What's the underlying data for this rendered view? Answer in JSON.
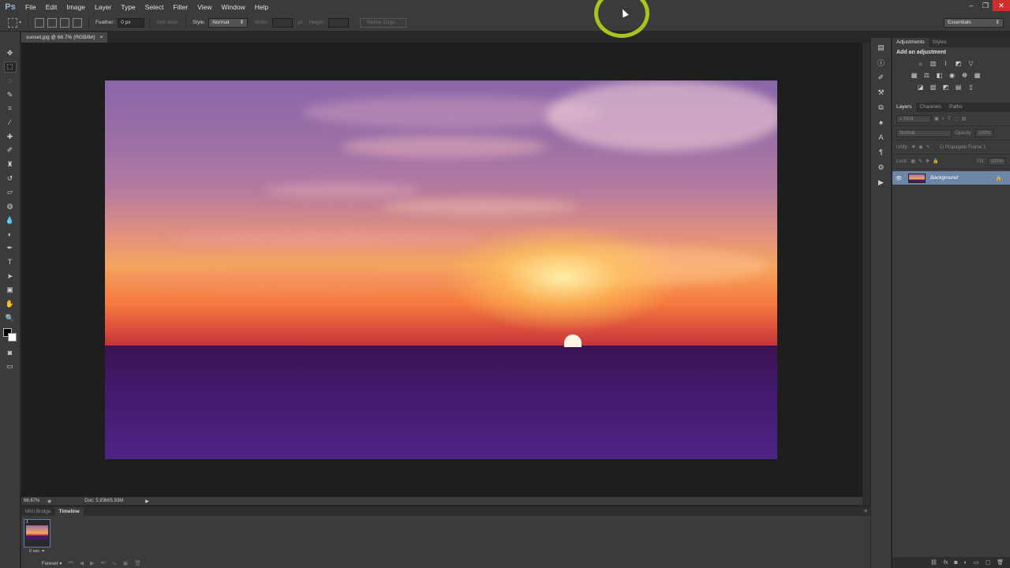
{
  "app": {
    "logo": "Ps"
  },
  "menu": [
    "File",
    "Edit",
    "Image",
    "Layer",
    "Type",
    "Select",
    "Filter",
    "View",
    "Window",
    "Help"
  ],
  "window_controls": {
    "minimize": "–",
    "restore": "❐",
    "close": "✕"
  },
  "options": {
    "feather_label": "Feather:",
    "feather_value": "0 px",
    "antialias_label": "Anti-alias",
    "style_label": "Style:",
    "style_value": "Normal",
    "width_label": "Width:",
    "height_label": "Height:",
    "refine_edge": "Refine Edge...",
    "workspace": "Essentials"
  },
  "document": {
    "tab_title": "sunset.jpg @ 66.7% (RGB/8#)",
    "tab_close": "×",
    "zoom": "66.67%",
    "doc_size": "Doc: 5.93M/5.93M"
  },
  "bottom_panel": {
    "tabs": [
      "Mini Bridge",
      "Timeline"
    ],
    "frame_number": "1",
    "frame_delay": "0 sec.",
    "loop": "Forever"
  },
  "adjustments": {
    "tabs": [
      "Adjustments",
      "Styles"
    ],
    "title": "Add an adjustment"
  },
  "layers": {
    "tabs": [
      "Layers",
      "Channels",
      "Paths"
    ],
    "kind": "Kind",
    "blend_mode": "Normal",
    "opacity_label": "Opacity:",
    "opacity_value": "100%",
    "unify_label": "Unify:",
    "propagate": "Propagate Frame 1",
    "lock_label": "Lock:",
    "fill_label": "Fill:",
    "fill_value": "100%",
    "items": [
      {
        "name": "Background",
        "visible": true,
        "locked": true
      }
    ]
  },
  "colors": {
    "accent_selection": "#6d86a8",
    "cursor_ring": "#a6c61c"
  }
}
